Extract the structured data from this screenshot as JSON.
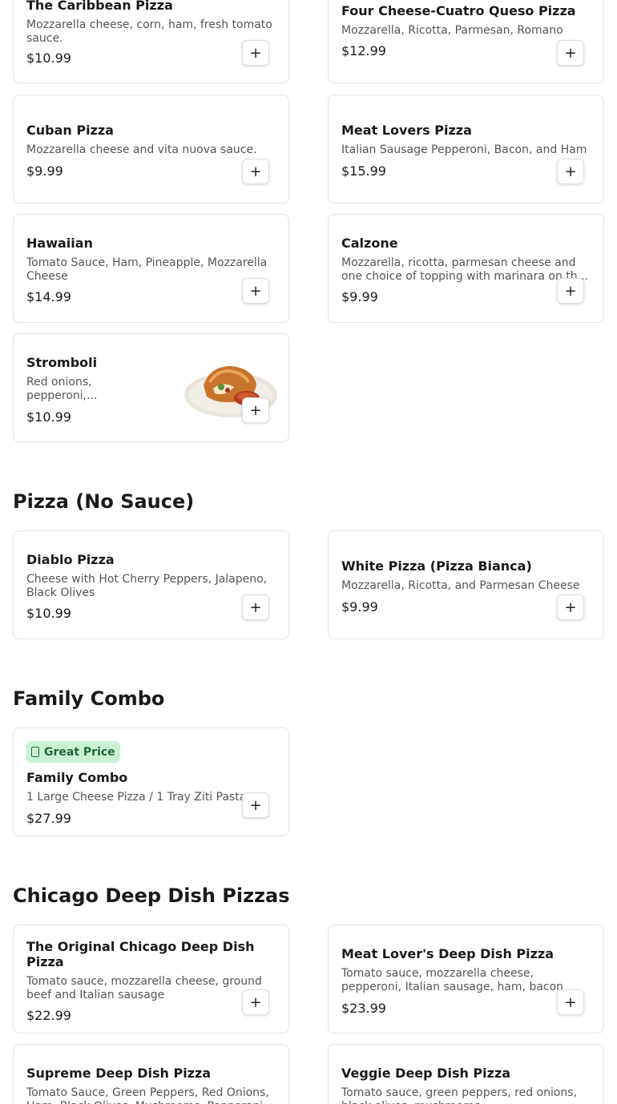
{
  "sections": {
    "no_sauce": {
      "title": "Pizza (No Sauce)"
    },
    "family_combo": {
      "title": "Family Combo"
    },
    "deep_dish": {
      "title": "Chicago Deep Dish Pizzas"
    }
  },
  "items": {
    "caribbean": {
      "name": "The Caribbean Pizza",
      "desc": "Mozzarella cheese, corn, ham, fresh tomato sauce.",
      "price": "$10.99"
    },
    "four_cheese": {
      "name": "Four Cheese-Cuatro Queso Pizza",
      "desc": "Mozzarella, Ricotta, Parmesan, Romano",
      "price": "$12.99"
    },
    "cuban": {
      "name": "Cuban Pizza",
      "desc": "Mozzarella cheese and vita nuova sauce.",
      "price": "$9.99"
    },
    "meat_lovers": {
      "name": "Meat Lovers Pizza",
      "desc": "Italian Sausage Pepperoni, Bacon, and Ham",
      "price": "$15.99"
    },
    "hawaiian": {
      "name": "Hawaiian",
      "desc": "Tomato Sauce, Ham, Pineapple, Mozzarella Cheese",
      "price": "$14.99"
    },
    "calzone": {
      "name": "Calzone",
      "desc": "Mozzarella, ricotta, parmesan cheese and one choice of topping with marinara on th...",
      "price": "$9.99"
    },
    "stromboli": {
      "name": "Stromboli",
      "desc": "Red onions, pepperoni,...",
      "price": "$10.99"
    },
    "diablo": {
      "name": "Diablo Pizza",
      "desc": "Cheese with Hot Cherry Peppers, Jalapeno, Black Olives",
      "price": "$10.99"
    },
    "white": {
      "name": "White Pizza (Pizza Bianca)",
      "desc": "Mozzarella, Ricotta, and Parmesan Cheese",
      "price": "$9.99"
    },
    "family_combo": {
      "badge": "Great Price",
      "name": "Family Combo",
      "desc": "1 Large Cheese Pizza / 1 Tray Ziti Pasta",
      "price": "$27.99"
    },
    "original_deep": {
      "name": "The Original Chicago Deep Dish Pizza",
      "desc": "Tomato sauce, mozzarella cheese, ground beef and Italian sausage",
      "price": "$22.99"
    },
    "meat_lover_deep": {
      "name": "Meat Lover's Deep Dish Pizza",
      "desc": "Tomato sauce, mozzarella cheese, pepperoni, Italian sausage, ham, bacon",
      "price": "$23.99"
    },
    "supreme_deep": {
      "name": "Supreme Deep Dish Pizza",
      "desc": "Tomato Sauce, Green Peppers, Red Onions, Ham, Black Olives, Mushrooms, Pepperoni"
    },
    "veggie_deep": {
      "name": "Veggie Deep Dish Pizza",
      "desc": "Tomato sauce, green peppers, red onions, black olives, mushrooms"
    }
  },
  "add_label": "+",
  "colors": {
    "badge_bg": "#c9f2d3",
    "badge_text": "#1f6b36",
    "border": "#e3e3e3"
  }
}
